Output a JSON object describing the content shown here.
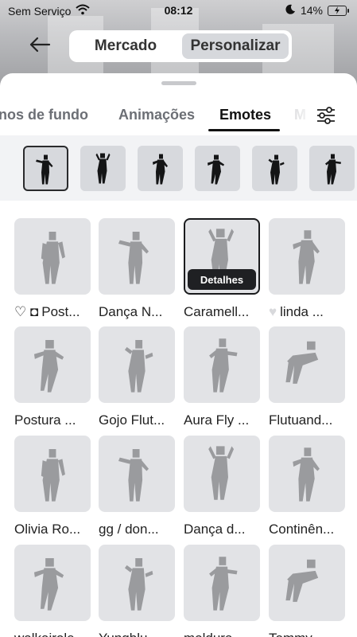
{
  "status_bar": {
    "carrier": "Sem Serviço",
    "time": "08:12",
    "battery": "14%",
    "icons": [
      "wifi-icon",
      "moon-icon",
      "battery-icon"
    ]
  },
  "header": {
    "back_icon": "arrow-left-icon",
    "segments": [
      {
        "label": "Mercado",
        "active": false
      },
      {
        "label": "Personalizar",
        "active": true
      }
    ]
  },
  "tabs": [
    {
      "label": "nos de fundo",
      "active": false
    },
    {
      "label": "Animações",
      "active": false
    },
    {
      "label": "Emotes",
      "active": true
    },
    {
      "label": "M",
      "active": false
    }
  ],
  "filter_icon": "sliders-icon",
  "equipped_slots": [
    {
      "selected": true
    },
    {
      "selected": false
    },
    {
      "selected": false
    },
    {
      "selected": false
    },
    {
      "selected": false
    },
    {
      "selected": false
    }
  ],
  "items": [
    {
      "label": "Post...",
      "prefix": "♡ ◘ "
    },
    {
      "label": "Dança N..."
    },
    {
      "label": "Caramell...",
      "selected": true,
      "overlay": "Detalhes"
    },
    {
      "label": "linda ...",
      "prefix": "♥ "
    },
    {
      "label": "Postura ..."
    },
    {
      "label": "Gojo Flut..."
    },
    {
      "label": "Aura Fly ..."
    },
    {
      "label": "Flutuand..."
    },
    {
      "label": "Olivia Ro..."
    },
    {
      "label": "gg / don..."
    },
    {
      "label": "Dança d..."
    },
    {
      "label": "Continên..."
    },
    {
      "label": "walkairole"
    },
    {
      "label": "Yungblu..."
    },
    {
      "label": "moldura..."
    },
    {
      "label": "Tommy ..."
    }
  ],
  "colors": {
    "accent_dark": "#1f2023",
    "tile_bg": "#e2e3e6",
    "avatar": "#9a9b9e"
  }
}
